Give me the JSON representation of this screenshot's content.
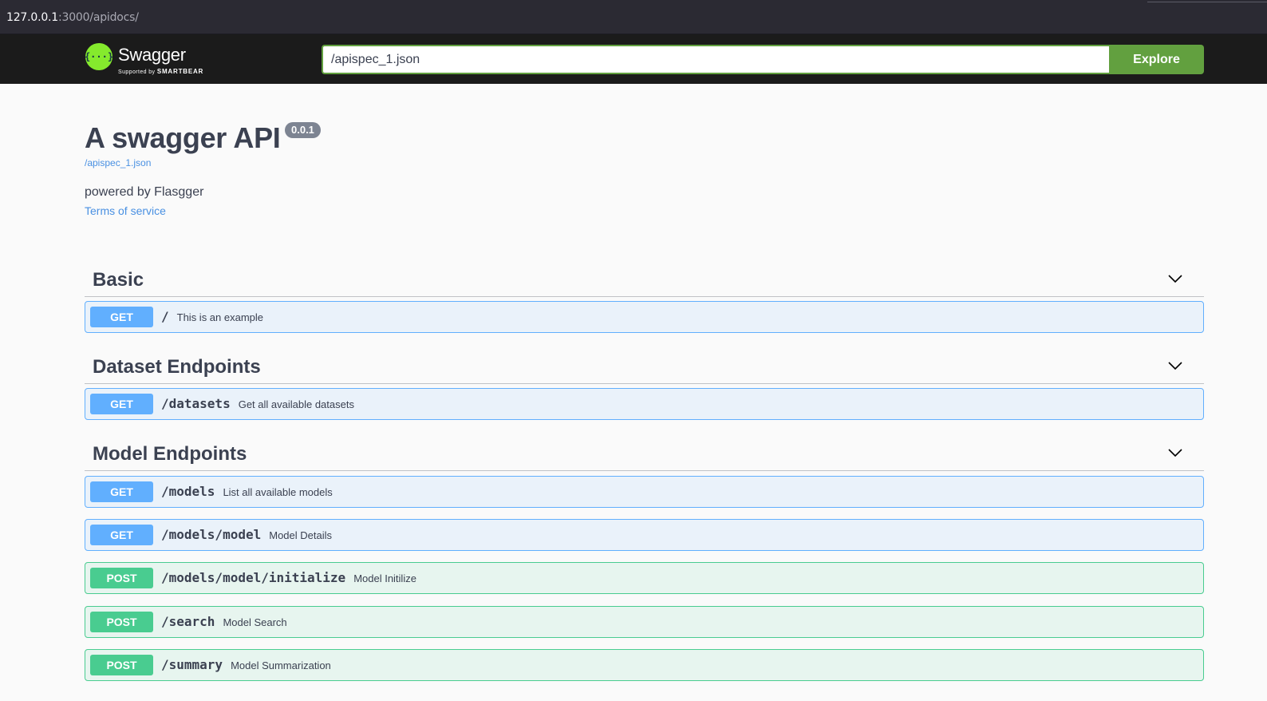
{
  "browser": {
    "url_host": "127.0.0.1",
    "url_rest": ":3000/apidocs/"
  },
  "topbar": {
    "logo_text": "Swagger",
    "logo_sub_prefix": "Supported by",
    "logo_sub_brand": "SMARTBEAR",
    "spec_url_value": "/apispec_1.json",
    "explore_label": "Explore"
  },
  "info": {
    "title": "A swagger API",
    "version": "0.0.1",
    "spec_link": "/apispec_1.json",
    "description": "powered by Flasgger",
    "tos_label": "Terms of service"
  },
  "tags": [
    {
      "name": "Basic",
      "operations": [
        {
          "method": "GET",
          "path": "/",
          "summary": "This is an example"
        }
      ]
    },
    {
      "name": "Dataset Endpoints",
      "operations": [
        {
          "method": "GET",
          "path": "/datasets",
          "summary": "Get all available datasets"
        }
      ]
    },
    {
      "name": "Model Endpoints",
      "operations": [
        {
          "method": "GET",
          "path": "/models",
          "summary": "List all available models"
        },
        {
          "method": "GET",
          "path": "/models/model",
          "summary": "Model Details"
        },
        {
          "method": "POST",
          "path": "/models/model/initialize",
          "summary": "Model Initilize"
        },
        {
          "method": "POST",
          "path": "/search",
          "summary": "Model Search"
        },
        {
          "method": "POST",
          "path": "/summary",
          "summary": "Model Summarization"
        }
      ]
    }
  ],
  "colors": {
    "get": "#61affe",
    "post": "#49cc90",
    "explore": "#62a03f",
    "link": "#4990e2",
    "text": "#3b4151"
  }
}
